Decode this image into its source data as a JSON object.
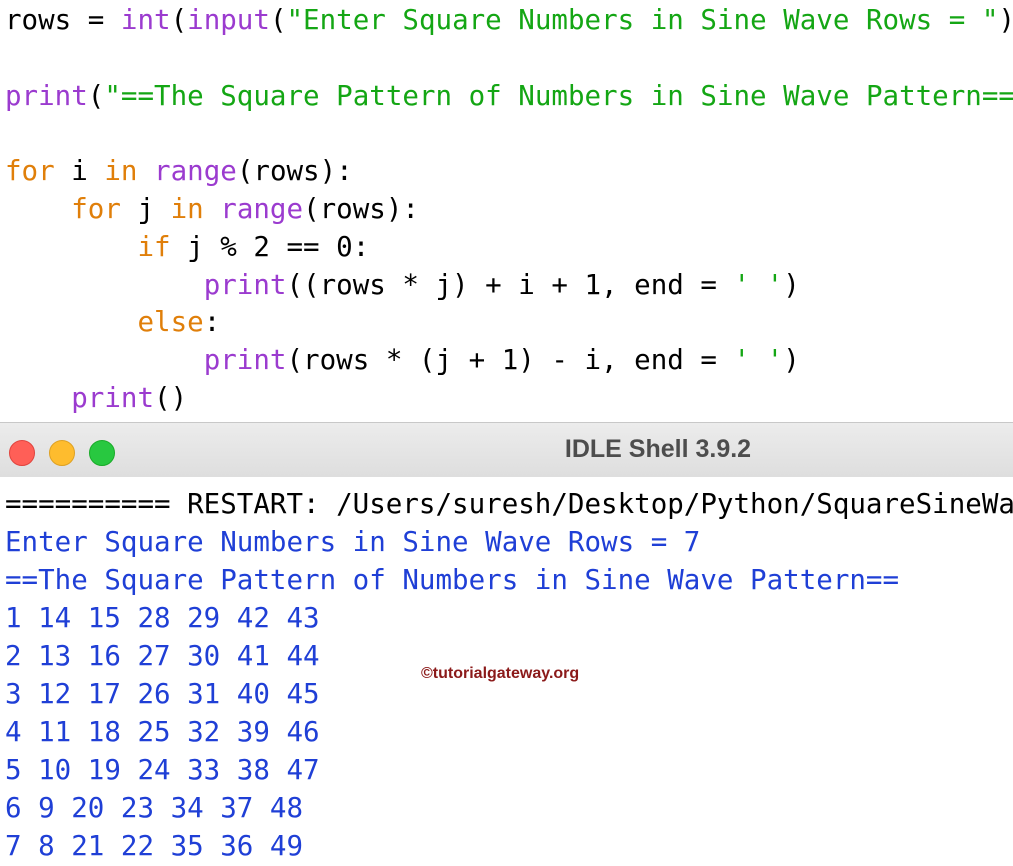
{
  "editor": {
    "lines": [
      [
        {
          "t": "rows = ",
          "c": "plain"
        },
        {
          "t": "int",
          "c": "builtin"
        },
        {
          "t": "(",
          "c": "plain"
        },
        {
          "t": "input",
          "c": "builtin"
        },
        {
          "t": "(",
          "c": "plain"
        },
        {
          "t": "\"Enter Square Numbers in Sine Wave Rows = \"",
          "c": "string"
        },
        {
          "t": "))",
          "c": "plain"
        }
      ],
      [],
      [
        {
          "t": "print",
          "c": "builtin"
        },
        {
          "t": "(",
          "c": "plain"
        },
        {
          "t": "\"==The Square Pattern of Numbers in Sine Wave Pattern==\"",
          "c": "string"
        },
        {
          "t": ")",
          "c": "plain"
        }
      ],
      [],
      [
        {
          "t": "for",
          "c": "keyword"
        },
        {
          "t": " i ",
          "c": "plain"
        },
        {
          "t": "in",
          "c": "keyword"
        },
        {
          "t": " ",
          "c": "plain"
        },
        {
          "t": "range",
          "c": "builtin"
        },
        {
          "t": "(rows):",
          "c": "plain"
        }
      ],
      [
        {
          "t": "    ",
          "c": "plain"
        },
        {
          "t": "for",
          "c": "keyword"
        },
        {
          "t": " j ",
          "c": "plain"
        },
        {
          "t": "in",
          "c": "keyword"
        },
        {
          "t": " ",
          "c": "plain"
        },
        {
          "t": "range",
          "c": "builtin"
        },
        {
          "t": "(rows):",
          "c": "plain"
        }
      ],
      [
        {
          "t": "        ",
          "c": "plain"
        },
        {
          "t": "if",
          "c": "keyword"
        },
        {
          "t": " j % 2 == 0:",
          "c": "plain"
        }
      ],
      [
        {
          "t": "            ",
          "c": "plain"
        },
        {
          "t": "print",
          "c": "builtin"
        },
        {
          "t": "((rows * j) + i + 1, end = ",
          "c": "plain"
        },
        {
          "t": "' '",
          "c": "string"
        },
        {
          "t": ")",
          "c": "plain"
        }
      ],
      [
        {
          "t": "        ",
          "c": "plain"
        },
        {
          "t": "else",
          "c": "keyword"
        },
        {
          "t": ":",
          "c": "plain"
        }
      ],
      [
        {
          "t": "            ",
          "c": "plain"
        },
        {
          "t": "print",
          "c": "builtin"
        },
        {
          "t": "(rows * (j + 1) - i, end = ",
          "c": "plain"
        },
        {
          "t": "' '",
          "c": "string"
        },
        {
          "t": ")",
          "c": "plain"
        }
      ],
      [
        {
          "t": "    ",
          "c": "plain"
        },
        {
          "t": "print",
          "c": "builtin"
        },
        {
          "t": "()",
          "c": "plain"
        }
      ]
    ]
  },
  "window": {
    "title": "IDLE Shell 3.9.2",
    "buttons": {
      "close": "#ff5f57",
      "minimize": "#febc2e",
      "zoom": "#28c840"
    }
  },
  "shell": {
    "restart_line": "========== RESTART: /Users/suresh/Desktop/Python/SquareSineWave",
    "prompt_line": "Enter Square Numbers in Sine Wave Rows = 7",
    "header_line": "==The Square Pattern of Numbers in Sine Wave Pattern==",
    "output_rows": [
      "1 14 15 28 29 42 43",
      "2 13 16 27 30 41 44",
      "3 12 17 26 31 40 45",
      "4 11 18 25 32 39 46",
      "5 10 19 24 33 38 47",
      "6 9 20 23 34 37 48",
      "7 8 21 22 35 36 49"
    ]
  },
  "watermark": "©tutorialgateway.org",
  "colors": {
    "keyword": "#e07f0a",
    "builtin": "#9b3bcf",
    "string": "#14a614",
    "shell_output": "#1f3fd6"
  }
}
